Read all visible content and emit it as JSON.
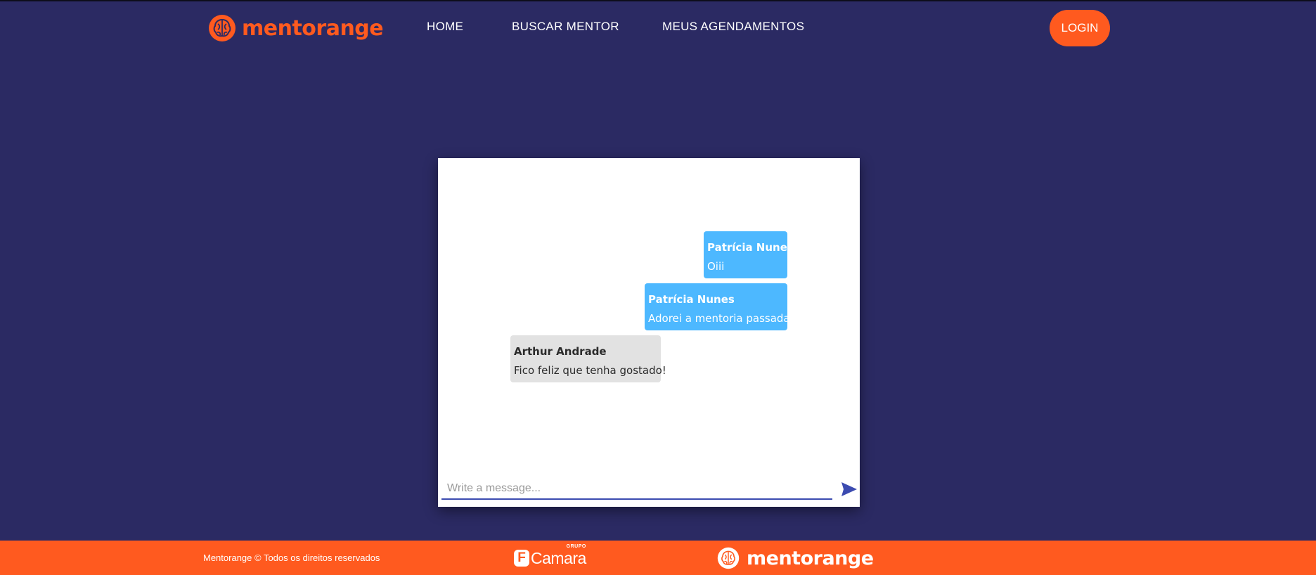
{
  "brand": {
    "name": "mentorange",
    "colors": {
      "background": "#2b2a63",
      "accent": "#ff5a1f",
      "bubble_mine": "#4db8ff",
      "bubble_theirs": "#e2e2e2",
      "input_line": "#3c4bb0"
    }
  },
  "nav": {
    "items": [
      {
        "label": "HOME"
      },
      {
        "label": "BUSCAR MENTOR"
      },
      {
        "label": "MEUS AGENDAMENTOS"
      }
    ],
    "login_label": "LOGIN"
  },
  "chat": {
    "messages": [
      {
        "author": "Patrícia Nunes",
        "text": "Oiii",
        "mine": true
      },
      {
        "author": "Patrícia Nunes",
        "text": "Adorei a mentoria passada!",
        "mine": true
      },
      {
        "author": "Arthur Andrade",
        "text": "Fico feliz que tenha gostado!",
        "mine": false
      }
    ],
    "input": {
      "placeholder": "Write a message...",
      "value": ""
    },
    "send_icon": "send-icon"
  },
  "footer": {
    "copyright": "Mentorange © Todos os direitos reservados",
    "partner": {
      "badge": "F",
      "name": "Camara",
      "group": "GRUPO"
    },
    "logo_text": "mentorange"
  }
}
